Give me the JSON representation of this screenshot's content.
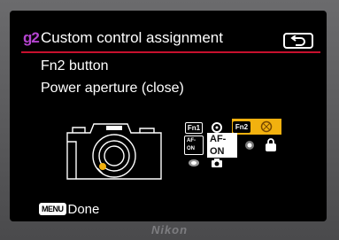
{
  "header": {
    "menu_code": "g2",
    "title": "Custom control assignment",
    "back_icon": "return-arrow-icon"
  },
  "content": {
    "line1": "Fn2 button",
    "line2": "Power aperture (close)"
  },
  "controls": {
    "fn1": "Fn1",
    "fn2": "Fn2",
    "af_label": "AF-ON",
    "afon_button": "AF-ON",
    "ae_lock": "AE-L"
  },
  "footer": {
    "menu_key": "MENU",
    "done_label": "Done"
  },
  "brand": "Nikon",
  "colors": {
    "accent_red": "#c8102e",
    "menu_code_purple": "#b544d0",
    "selected_yellow": "#f2b10f"
  }
}
